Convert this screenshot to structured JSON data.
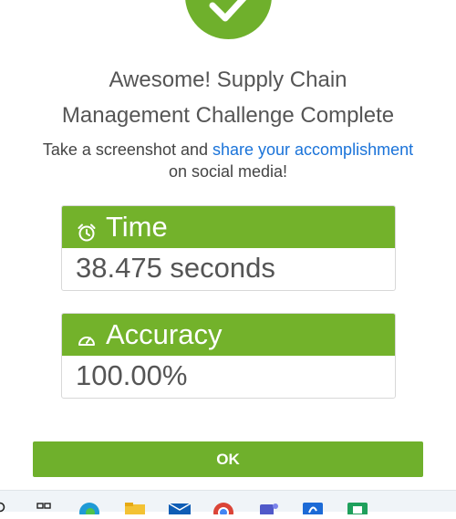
{
  "dialog": {
    "headline_line1": "Awesome! Supply Chain",
    "headline_line2": "Management Challenge Complete",
    "subtext_before": "Take a screenshot and ",
    "subtext_link": "share your accomplishment",
    "subtext_after": " on social media!",
    "accent_color": "#6fb02c",
    "link_color": "#1a73d9"
  },
  "stats": {
    "time": {
      "label": "Time",
      "value": "38.475 seconds",
      "icon": "alarm-clock-icon"
    },
    "accuracy": {
      "label": "Accuracy",
      "value": "100.00%",
      "icon": "speedometer-icon"
    }
  },
  "buttons": {
    "ok_label": "OK"
  },
  "taskbar": {
    "icons": [
      "search-icon",
      "task-view-icon",
      "edge-browser-icon",
      "file-explorer-icon",
      "mail-icon",
      "chrome-icon",
      "teams-icon",
      "app-store-icon",
      "media-app-icon"
    ]
  }
}
